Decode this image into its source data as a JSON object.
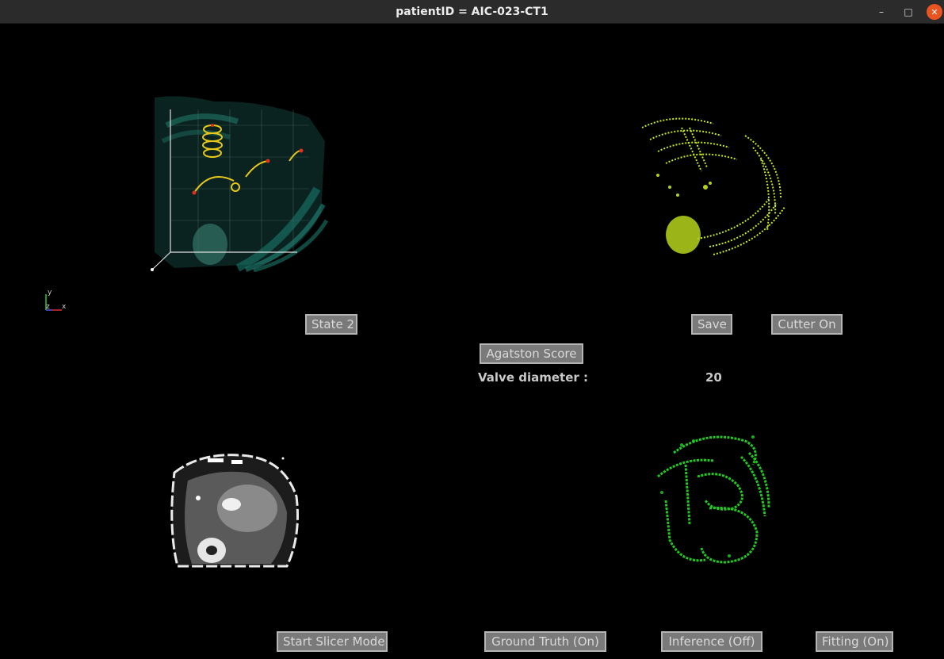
{
  "window": {
    "title": "patientID = AIC-023-CT1",
    "minimize_glyph": "–",
    "maximize_glyph": "□",
    "close_glyph": "✕"
  },
  "axes_widget": {
    "y": "y",
    "z": "z",
    "x": "x"
  },
  "buttons": {
    "state": "State 2",
    "save": "Save",
    "cutter": "Cutter On",
    "agatston": "Agatston Score",
    "start_slicer": "Start Slicer Mode",
    "ground_truth": "Ground Truth (On)",
    "inference": "Inference (Off)",
    "fitting": "Fitting (On)"
  },
  "valve": {
    "label": "Valve diameter :",
    "value": "20"
  },
  "colors": {
    "titlebar": "#2b2b2b",
    "close": "#e95420",
    "button_bg": "#7a7a7a",
    "yellow_green": "#c8e81e",
    "green": "#22d422",
    "teal": "#1f8f7f"
  }
}
